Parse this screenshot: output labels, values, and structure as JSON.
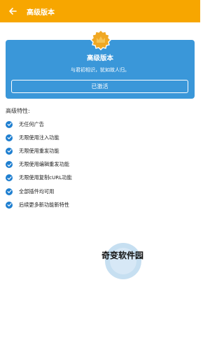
{
  "appbar": {
    "back_icon": "arrow-left-icon",
    "title": "高级版本",
    "color": "#f7a600"
  },
  "card": {
    "badge_icon": "crown-badge-icon",
    "title": "高级版本",
    "subtitle": "与君初相识，犹如故人归。",
    "button_label": "已激活",
    "color": "#3a97d9"
  },
  "features": {
    "heading": "高级特性:",
    "check_icon": "check-circle-icon",
    "items": [
      "无任何广告",
      "无限使用注入功能",
      "无限使用重发功能",
      "无限使用编辑重发功能",
      "无限使用复制cURL功能",
      "全部插件均可用",
      "后续更多新功能新特性"
    ]
  },
  "watermark": {
    "text": "奇变软件园"
  }
}
